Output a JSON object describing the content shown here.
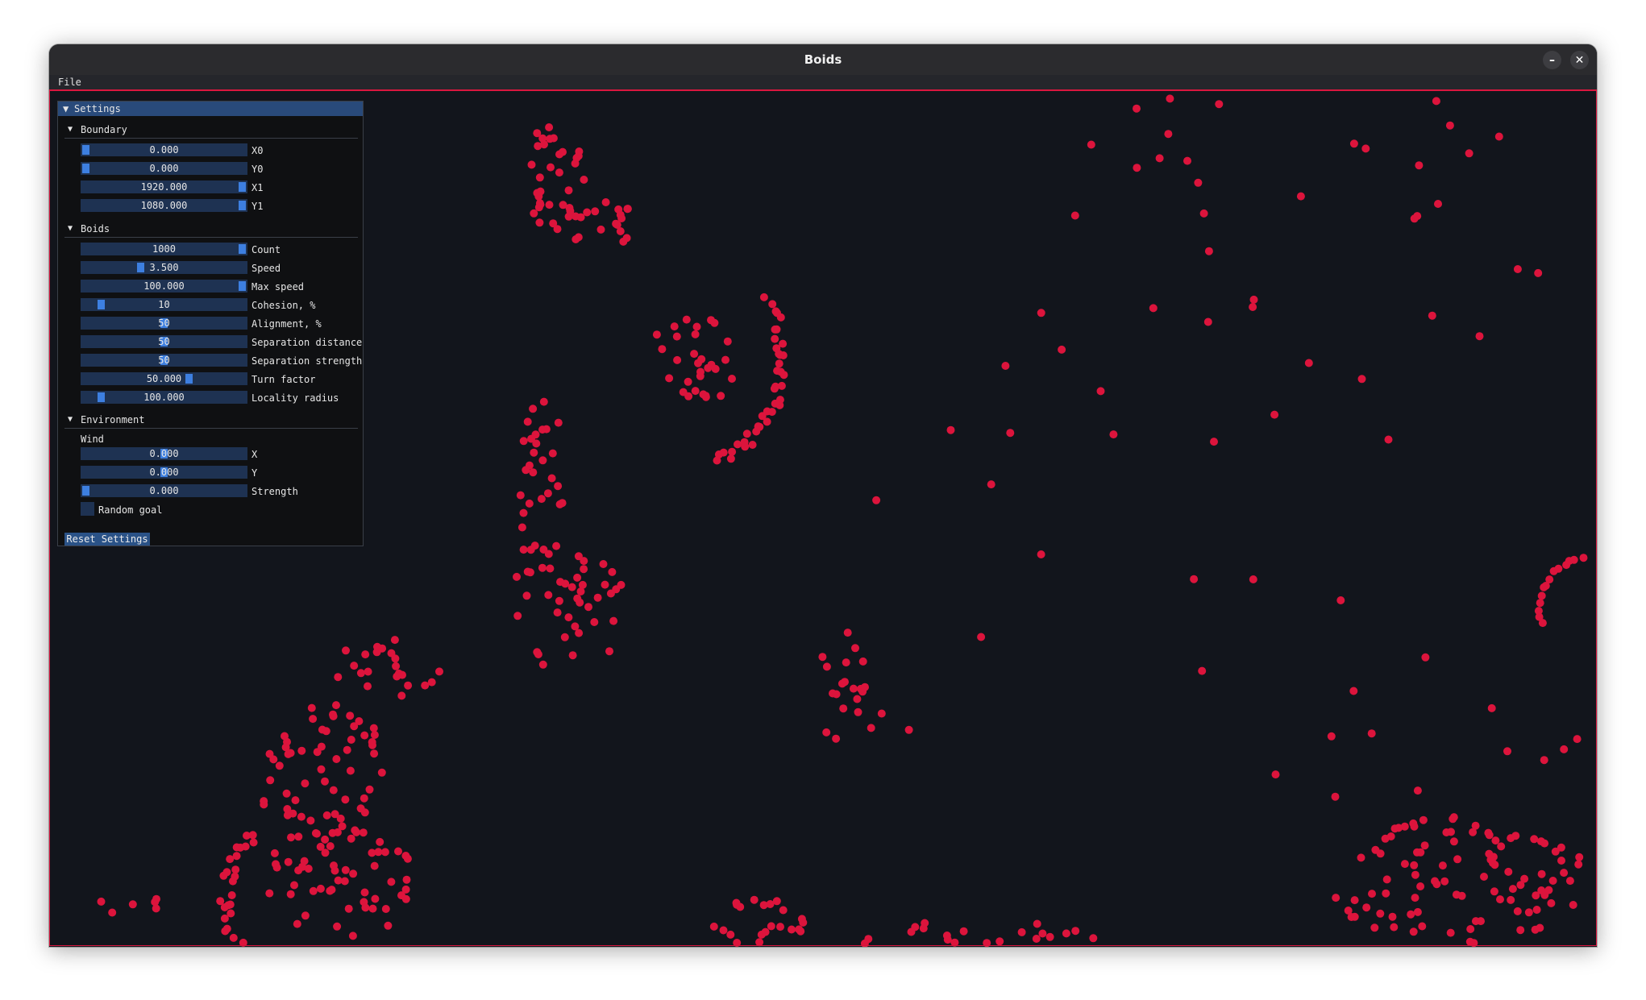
{
  "window": {
    "title": "Boids",
    "minimize_icon": "minimize-icon",
    "close_icon": "close-icon"
  },
  "menu": {
    "file": "File"
  },
  "colors": {
    "accent": "#d9173f",
    "boid": "#dc143c",
    "background": "#12151c",
    "slider_bg": "#1e3252",
    "grab": "#3d7fe0",
    "header": "#294a7a"
  },
  "settings": {
    "title": "Settings",
    "boundary": {
      "label": "Boundary",
      "x0": {
        "label": "X0",
        "value": "0.000",
        "fraction": 0.0
      },
      "y0": {
        "label": "Y0",
        "value": "0.000",
        "fraction": 0.0
      },
      "x1": {
        "label": "X1",
        "value": "1920.000",
        "fraction": 1.0
      },
      "y1": {
        "label": "Y1",
        "value": "1080.000",
        "fraction": 1.0
      }
    },
    "boids": {
      "label": "Boids",
      "count": {
        "label": "Count",
        "value": "1000",
        "fraction": 1.0
      },
      "speed": {
        "label": "Speed",
        "value": "3.500",
        "fraction": 0.35
      },
      "max_speed": {
        "label": "Max speed",
        "value": "100.000",
        "fraction": 1.0
      },
      "cohesion": {
        "label": "Cohesion, %",
        "value": "10",
        "fraction": 0.1
      },
      "alignment": {
        "label": "Alignment, %",
        "value": "50",
        "fraction": 0.5
      },
      "separation_distance": {
        "label": "Separation distance",
        "value": "50",
        "fraction": 0.5
      },
      "separation_strength": {
        "label": "Separation strength",
        "value": "50",
        "fraction": 0.5
      },
      "turn_factor": {
        "label": "Turn factor",
        "value": "50.000",
        "fraction": 0.66
      },
      "locality_radius": {
        "label": "Locality radius",
        "value": "100.000",
        "fraction": 0.1
      }
    },
    "environment": {
      "label": "Environment",
      "wind_label": "Wind",
      "wind_x": {
        "label": "X",
        "value": "0.000",
        "fraction": 0.5
      },
      "wind_y": {
        "label": "Y",
        "value": "0.000",
        "fraction": 0.5
      },
      "strength": {
        "label": "Strength",
        "value": "0.000",
        "fraction": 0.0
      },
      "random_goal": {
        "label": "Random goal",
        "checked": false
      }
    },
    "reset_label": "Reset Settings"
  }
}
